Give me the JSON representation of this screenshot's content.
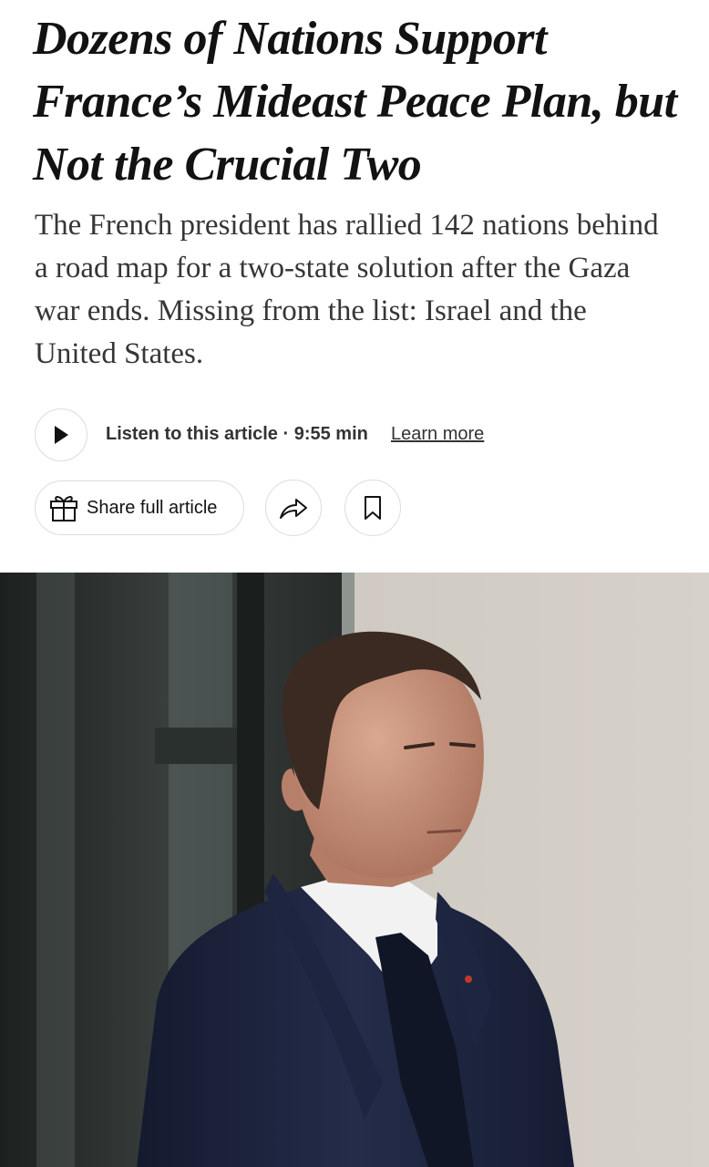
{
  "article": {
    "headline": "Dozens of Nations Support France’s Mideast Peace Plan, but Not the Crucial Two",
    "summary": "The French president has rallied 142 nations behind a road map for a two-state solution after the Gaza war ends. Missing from the list: Israel and the United States."
  },
  "audio": {
    "play_icon": "play-icon",
    "listen_label": "Listen to this article · 9:55 min",
    "learn_more": "Learn more"
  },
  "actions": {
    "share_full_label": "Share full article",
    "share_icon": "gift-icon",
    "share_arrow_icon": "share-arrow-icon",
    "bookmark_icon": "bookmark-icon"
  },
  "photo": {
    "colors": {
      "suit": "#1d2440",
      "wall": "#c9c4bc",
      "window": "#2f3533"
    }
  }
}
